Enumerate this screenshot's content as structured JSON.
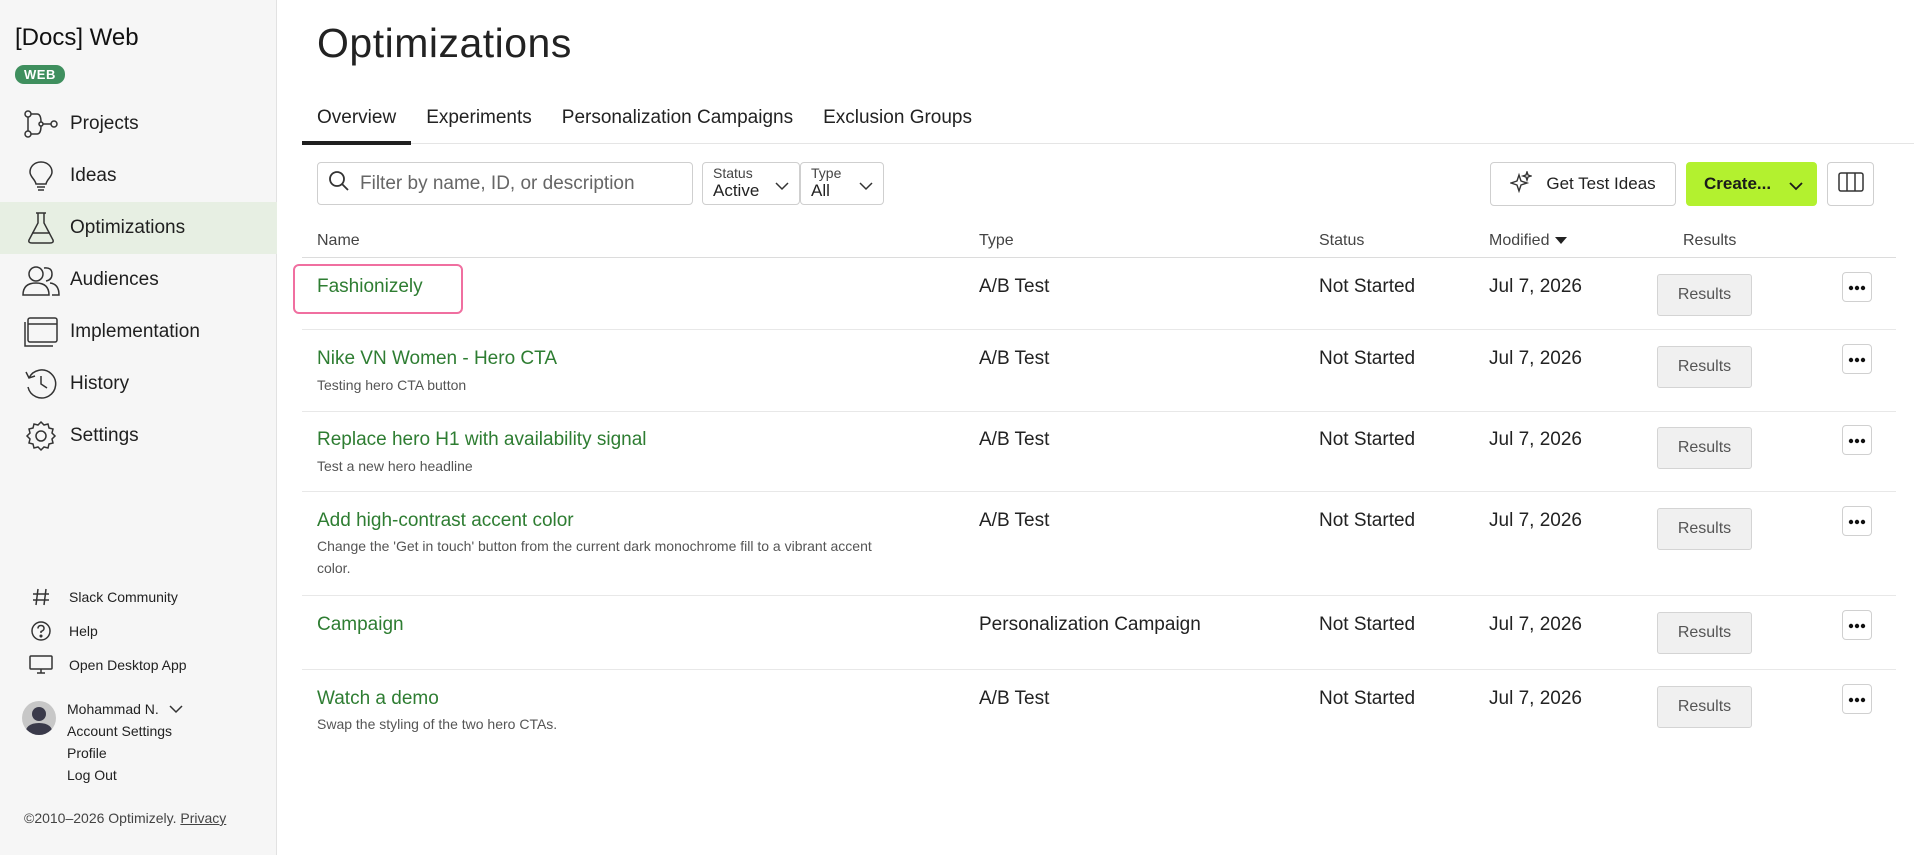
{
  "sidebar": {
    "project_title": "[Docs] Web",
    "project_badge": "WEB",
    "nav": [
      {
        "label": "Projects",
        "icon": "projects-icon"
      },
      {
        "label": "Ideas",
        "icon": "lightbulb-icon"
      },
      {
        "label": "Optimizations",
        "icon": "flask-icon",
        "active": true
      },
      {
        "label": "Audiences",
        "icon": "audiences-icon"
      },
      {
        "label": "Implementation",
        "icon": "browser-window-icon"
      },
      {
        "label": "History",
        "icon": "history-icon"
      },
      {
        "label": "Settings",
        "icon": "gear-icon"
      }
    ],
    "utilities": [
      {
        "label": "Slack Community",
        "icon": "hash-icon"
      },
      {
        "label": "Help",
        "icon": "help-icon"
      },
      {
        "label": "Open Desktop App",
        "icon": "desktop-icon"
      }
    ],
    "user": {
      "name": "Mohammad N.",
      "menu": [
        "Account Settings",
        "Profile",
        "Log Out"
      ]
    },
    "footer": {
      "copyright": "©2010–2026 Optimizely.",
      "privacy": "Privacy"
    }
  },
  "main": {
    "title": "Optimizations",
    "tabs": [
      "Overview",
      "Experiments",
      "Personalization Campaigns",
      "Exclusion Groups"
    ],
    "active_tab": "Overview",
    "filter": {
      "placeholder": "Filter by name, ID, or description",
      "value": ""
    },
    "status_select": {
      "label": "Status",
      "value": "Active"
    },
    "type_select": {
      "label": "Type",
      "value": "All"
    },
    "get_ideas_label": "Get Test Ideas",
    "create_label": "Create...",
    "columns": {
      "name": "Name",
      "type": "Type",
      "status": "Status",
      "modified": "Modified",
      "results": "Results"
    },
    "rows": [
      {
        "name": "Fashionizely",
        "desc": "",
        "type": "A/B Test",
        "status": "Not Started",
        "modified": "Jul 7, 2026",
        "results": "Results"
      },
      {
        "name": "Nike VN Women - Hero CTA",
        "desc": "Testing hero CTA button",
        "type": "A/B Test",
        "status": "Not Started",
        "modified": "Jul 7, 2026",
        "results": "Results"
      },
      {
        "name": "Replace hero H1 with availability signal",
        "desc": "Test a new hero headline",
        "type": "A/B Test",
        "status": "Not Started",
        "modified": "Jul 7, 2026",
        "results": "Results"
      },
      {
        "name": "Add high-contrast accent color",
        "desc": "Change the 'Get in touch' button from the current dark monochrome fill to a vibrant accent",
        "desc2": "color.",
        "type": "A/B Test",
        "status": "Not Started",
        "modified": "Jul 7, 2026",
        "results": "Results"
      },
      {
        "name": "Campaign",
        "desc": "",
        "type": "Personalization Campaign",
        "status": "Not Started",
        "modified": "Jul 7, 2026",
        "results": "Results"
      },
      {
        "name": "Watch a demo",
        "desc": "Swap the styling of the two hero CTAs.",
        "type": "A/B Test",
        "status": "Not Started",
        "modified": "Jul 7, 2026",
        "results": "Results"
      }
    ]
  },
  "colors": {
    "accent": "#b3f12f",
    "link": "#2e7d32",
    "badge": "#3f8f5e",
    "highlight": "#f06fa0"
  }
}
